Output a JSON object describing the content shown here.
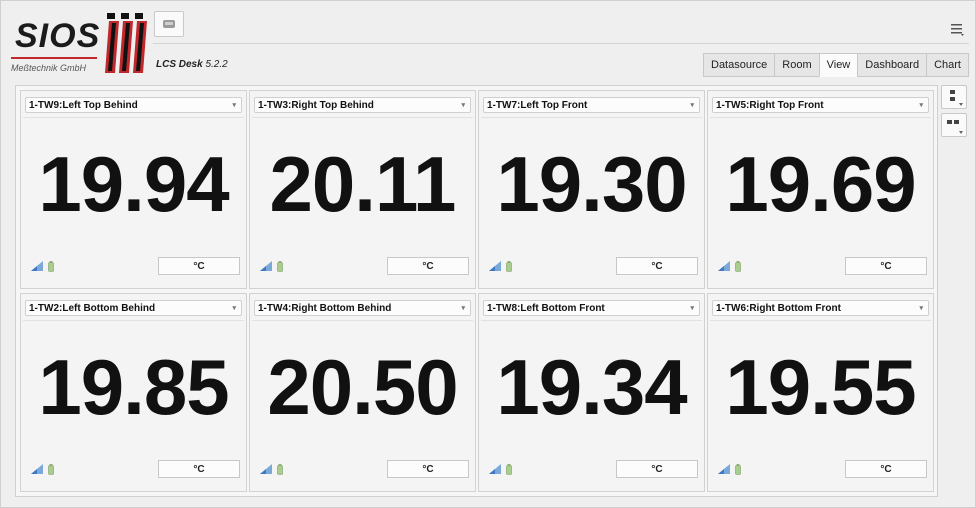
{
  "brand": {
    "logo_text": "SIOS",
    "company": "Meßtechnik GmbH",
    "app_name": "LCS Desk",
    "version": "5.2.2",
    "accent": "#c0282b"
  },
  "tabs": [
    {
      "label": "Datasource",
      "active": false
    },
    {
      "label": "Room",
      "active": false
    },
    {
      "label": "View",
      "active": true
    },
    {
      "label": "Dashboard",
      "active": false
    },
    {
      "label": "Chart",
      "active": false
    }
  ],
  "panels": [
    {
      "sensor": "1-TW9:Left Top Behind",
      "value": "19.94",
      "unit": "°C"
    },
    {
      "sensor": "1-TW3:Right Top Behind",
      "value": "20.11",
      "unit": "°C"
    },
    {
      "sensor": "1-TW7:Left Top Front",
      "value": "19.30",
      "unit": "°C"
    },
    {
      "sensor": "1-TW5:Right Top Front",
      "value": "19.69",
      "unit": "°C"
    },
    {
      "sensor": "1-TW2:Left Bottom Behind",
      "value": "19.85",
      "unit": "°C"
    },
    {
      "sensor": "1-TW4:Right Bottom Behind",
      "value": "20.50",
      "unit": "°C"
    },
    {
      "sensor": "1-TW8:Left Bottom Front",
      "value": "19.34",
      "unit": "°C"
    },
    {
      "sensor": "1-TW6:Right Bottom Front",
      "value": "19.55",
      "unit": "°C"
    }
  ],
  "icons": {
    "menu": "hamburger-menu-icon",
    "top_button": "device-icon",
    "signal": "signal-strength-icon",
    "battery": "battery-icon",
    "layout_single": "layout-single-icon",
    "layout_grid": "layout-grid-icon"
  }
}
